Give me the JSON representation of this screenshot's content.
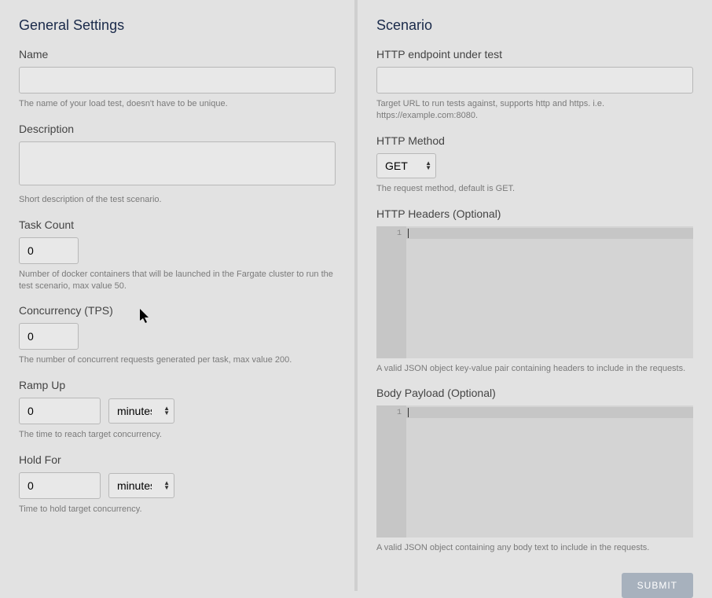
{
  "general": {
    "title": "General Settings",
    "name": {
      "label": "Name",
      "value": "",
      "help": "The name of your load test, doesn't have to be unique."
    },
    "description": {
      "label": "Description",
      "value": "",
      "help": "Short description of the test scenario."
    },
    "taskCount": {
      "label": "Task Count",
      "value": "0",
      "help": "Number of docker containers that will be launched in the Fargate cluster to run the test scenario, max value 50."
    },
    "concurrency": {
      "label": "Concurrency (TPS)",
      "value": "0",
      "help": "The number of concurrent requests generated per task, max value 200."
    },
    "rampUp": {
      "label": "Ramp Up",
      "value": "0",
      "unit": "minutes",
      "help": "The time to reach target concurrency."
    },
    "holdFor": {
      "label": "Hold For",
      "value": "0",
      "unit": "minutes",
      "help": "Time to hold target concurrency."
    }
  },
  "scenario": {
    "title": "Scenario",
    "endpoint": {
      "label": "HTTP endpoint under test",
      "value": "",
      "help": "Target URL to run tests against, supports http and https. i.e. https://example.com:8080."
    },
    "method": {
      "label": "HTTP Method",
      "value": "GET",
      "help": "The request method, default is GET."
    },
    "headers": {
      "label": "HTTP Headers (Optional)",
      "lineNumber": "1",
      "help": "A valid JSON object key-value pair containing headers to include in the requests."
    },
    "body": {
      "label": "Body Payload (Optional)",
      "lineNumber": "1",
      "help": "A valid JSON object containing any body text to include in the requests."
    },
    "submit": "SUBMIT"
  }
}
